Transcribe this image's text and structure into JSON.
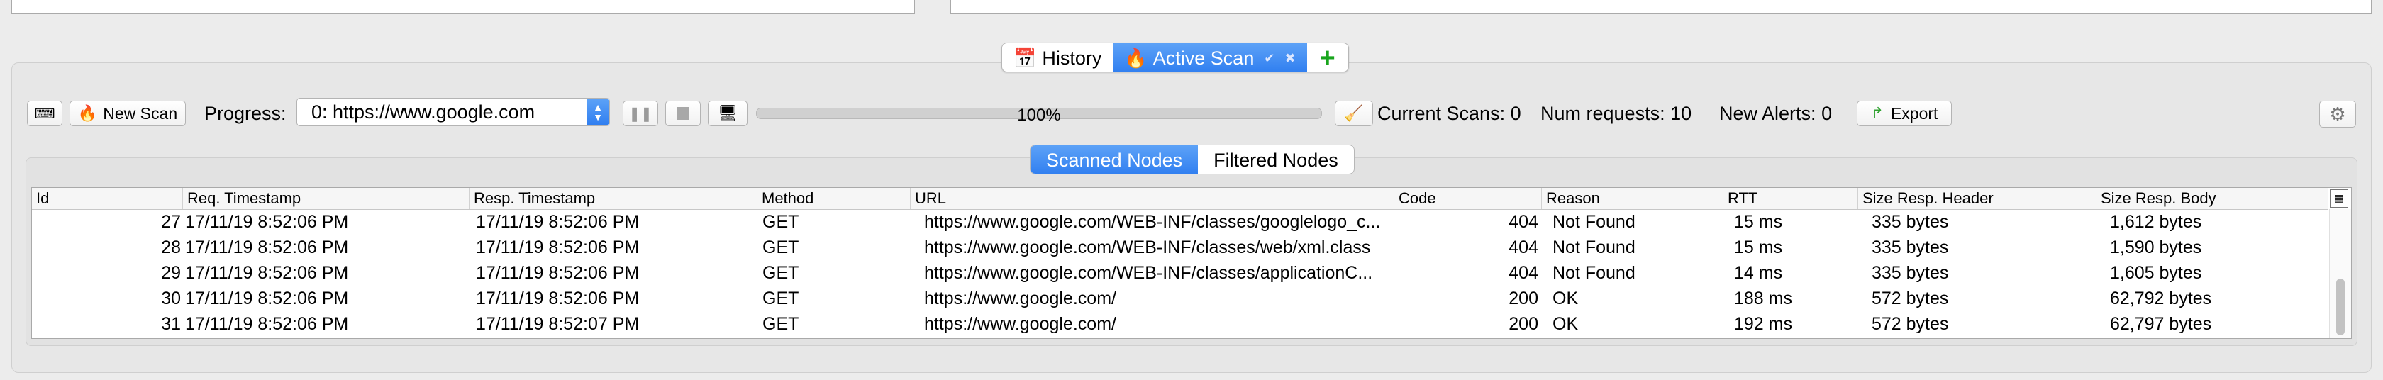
{
  "tabs": {
    "history_label": "History",
    "history_icon": "calendar-icon",
    "active_label": "Active Scan",
    "active_icon": "flame-icon",
    "active_close": "✖",
    "active_pin": "✔",
    "add_icon": "plus-icon",
    "add_glyph": "+"
  },
  "toolbar": {
    "new_scan_label": "New Scan",
    "progress_label": "Progress:",
    "scan_select_value": "0: https://www.google.com",
    "progress_percent": 100,
    "progress_text": "100%",
    "current_scans_label": "Current Scans:",
    "current_scans_value": "0",
    "num_requests_label": "Num requests:",
    "num_requests_value": "10",
    "new_alerts_label": "New Alerts:",
    "new_alerts_value": "0",
    "export_label": "Export"
  },
  "subtabs": {
    "scanned": "Scanned Nodes",
    "filtered": "Filtered Nodes"
  },
  "table": {
    "headers": [
      "Id",
      "Req. Timestamp",
      "Resp. Timestamp",
      "Method",
      "URL",
      "Code",
      "Reason",
      "RTT",
      "Size Resp. Header",
      "Size Resp. Body"
    ],
    "rows": [
      [
        "27",
        "17/11/19 8:52:06 PM",
        "17/11/19 8:52:06 PM",
        "GET",
        "https://www.google.com/WEB-INF/classes/googlelogo_c...",
        "404",
        "Not Found",
        "15 ms",
        "335 bytes",
        "1,612 bytes"
      ],
      [
        "28",
        "17/11/19 8:52:06 PM",
        "17/11/19 8:52:06 PM",
        "GET",
        "https://www.google.com/WEB-INF/classes/web/xml.class",
        "404",
        "Not Found",
        "15 ms",
        "335 bytes",
        "1,590 bytes"
      ],
      [
        "29",
        "17/11/19 8:52:06 PM",
        "17/11/19 8:52:06 PM",
        "GET",
        "https://www.google.com/WEB-INF/classes/applicationC...",
        "404",
        "Not Found",
        "14 ms",
        "335 bytes",
        "1,605 bytes"
      ],
      [
        "30",
        "17/11/19 8:52:06 PM",
        "17/11/19 8:52:06 PM",
        "GET",
        "https://www.google.com/",
        "200",
        "OK",
        "188 ms",
        "572 bytes",
        "62,792 bytes"
      ],
      [
        "31",
        "17/11/19 8:52:06 PM",
        "17/11/19 8:52:07 PM",
        "GET",
        "https://www.google.com/",
        "200",
        "OK",
        "192 ms",
        "572 bytes",
        "62,797 bytes"
      ]
    ]
  }
}
